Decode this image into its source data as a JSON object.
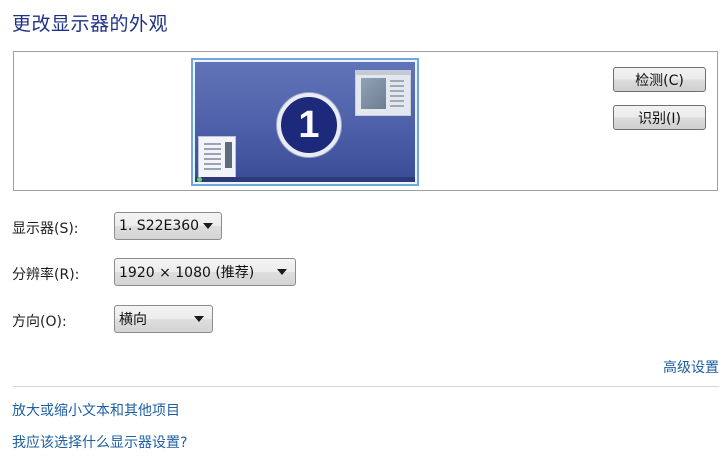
{
  "title": "更改显示器的外观",
  "preview": {
    "monitor_number": "1"
  },
  "buttons": {
    "detect": "检测(C)",
    "identify": "识别(I)"
  },
  "fields": [
    {
      "label": "显示器(S):",
      "value": "1. S22E360"
    },
    {
      "label": "分辨率(R):",
      "value": "1920 × 1080 (推荐)"
    },
    {
      "label": "方向(O):",
      "value": "横向"
    }
  ],
  "links": {
    "advanced": "高级设置",
    "text_size": "放大或缩小文本和其他项目",
    "which_settings": "我应该选择什么显示器设置?"
  },
  "colors": {
    "title": "#1e3287",
    "link": "#1f5fa0",
    "monitor_bg": "#4d5fa8",
    "monitor_number_bg": "#1d2a7c"
  }
}
